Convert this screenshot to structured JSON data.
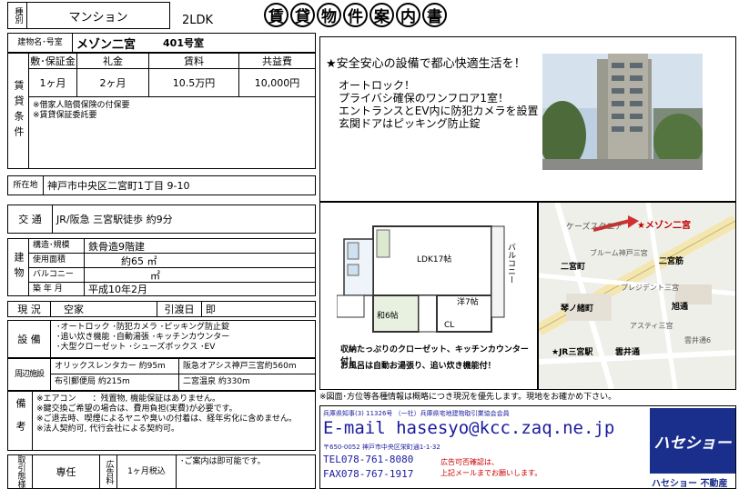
{
  "header": {
    "kind_label": "種別",
    "kind_value": "マンション",
    "layout": "2LDK",
    "title_chars": [
      "賃",
      "貸",
      "物",
      "件",
      "案",
      "内",
      "書"
    ]
  },
  "building": {
    "name_label": "建物名･号室",
    "name": "メゾン二宮",
    "room": "401号室"
  },
  "rent": {
    "section_label": "賃貸条件",
    "headers": [
      "敷･保証金",
      "礼金",
      "賃料",
      "共益費"
    ],
    "values": [
      "1ヶ月",
      "2ヶ月",
      "10.5万円",
      "10,000円"
    ],
    "notes": [
      "※借家人賠償保険の付保要",
      "※賃貸保証委託要"
    ]
  },
  "address": {
    "label": "所在地",
    "value": "神戸市中央区二宮町1丁目 9-10"
  },
  "transport": {
    "label": "交 通",
    "value": "JR/阪急 三宮駅徒歩 約9分"
  },
  "structure": {
    "section_label": "建物",
    "rows": [
      {
        "label": "構造･規模",
        "value": "鉄骨造9階建"
      },
      {
        "label": "使用面積",
        "value": "約65 ㎡"
      },
      {
        "label": "バルコニー",
        "value": "㎡"
      },
      {
        "label": "築 年 月",
        "value": "平成10年2月"
      }
    ]
  },
  "status": {
    "label": "現 況",
    "value": "空家",
    "handover_label": "引渡日",
    "handover": "即"
  },
  "equipment": {
    "label": "設 備",
    "lines": [
      "･オートロック ･防犯カメラ ･ピッキング防止錠",
      "･追い炊き機能 ･自動湯張 ･キッチンカウンター",
      "･大型クローゼット ･シューズボックス ･EV"
    ]
  },
  "nearby": {
    "label": "周辺施設",
    "items": [
      "オリックスレンタカー 約95m",
      "阪急オアシス神戸三宮約560m",
      "布引郵便局 約215m",
      "二宮温泉 約330m"
    ]
  },
  "remarks": {
    "label": "備考",
    "lines": [
      "※エアコン　　：残置物, 機能保証はありません。",
      "※鍵交換ご希望の場合は、費用負担(実費)が必要です。",
      "※ご退去時、喫煙によるヤニや臭いの付着は、経年劣化に含めません。",
      "※法人契約可, 代行会社による契約可。"
    ]
  },
  "bottom": {
    "type_label": "取引態様",
    "type": "専任",
    "ad_label": "広告料",
    "ad": "1ヶ月税込",
    "note": "･ご案内は即可能です。"
  },
  "pr": {
    "headline": "★安全安心の設備で都心快適生活を！",
    "lines": [
      "オートロック！",
      "プライバシ確保のワンフロア1室！",
      "エントランスとEV内に防犯カメラを設置",
      "玄関ドアはピッキング防止錠"
    ]
  },
  "floorplan": {
    "ldk": "LDK17帖",
    "western": "洋7帖",
    "japanese": "和6帖",
    "balcony": "バルコニー",
    "cl": "CL",
    "caption1": "収納たっぷりのクローゼット、キッチンカウンター付！",
    "caption2": "お風呂は自動お湯張り、追い炊き機能付！"
  },
  "map": {
    "labels": [
      "★メゾン二宮",
      "ケーズスクエア",
      "二宮町",
      "二宮筋",
      "旭通",
      "琴ノ緒町",
      "プレジデント三宮",
      "ブルーム神戸三宮",
      "★JR三宮駅",
      "雲井通",
      "アスティ三宮",
      "雲井通6"
    ]
  },
  "disclaimer": "※図面･方位等各種情報は概略につき現況を優先します。現地をお確かめ下さい。",
  "company": {
    "license": "兵庫県知事(3) 11326号 （一社）兵庫県宅地建物取引業協会会員",
    "email": "E-mail hasesyo@kcc.zaq.ne.jp",
    "address": "〒650-0052 神戸市中央区栄町通1-1-32",
    "tel": "TEL078-761-8080",
    "fax": "FAX078-767-1917",
    "note1": "広告可否確認は、",
    "note2": "上記メールまでお願いします。",
    "logo_text": "ハセショー",
    "name": "ハセショー 不動産"
  },
  "colors": {
    "red": "#cc0000",
    "blue": "#1a1aa0",
    "photo_sky": "#c8d8e8"
  }
}
